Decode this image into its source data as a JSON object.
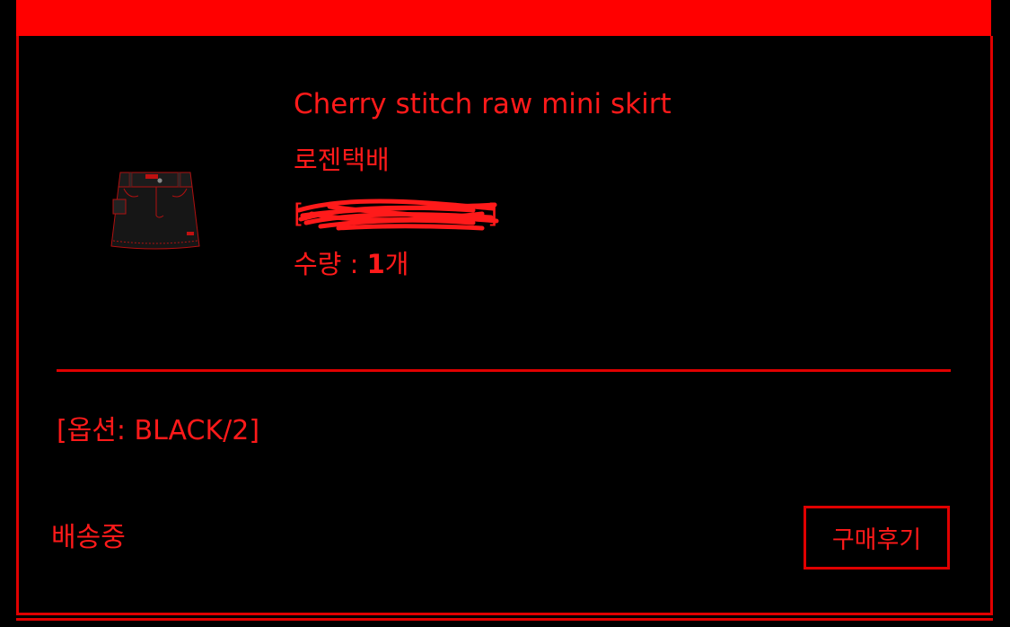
{
  "order": {
    "product_name": "Cherry stitch raw mini skirt",
    "courier": "로젠택배",
    "tracking_left_bracket": "[",
    "tracking_right_bracket": "]",
    "quantity_label": "수량 : ",
    "quantity_value": "1",
    "quantity_unit": "개",
    "option": "[옵션: BLACK/2]",
    "status": "배송중",
    "review_button_label": "구매후기",
    "thumbnail_icon": "denim-mini-skirt-image"
  },
  "colors": {
    "accent": "#ff0000",
    "text": "#ff1a1a",
    "background": "#000000"
  }
}
